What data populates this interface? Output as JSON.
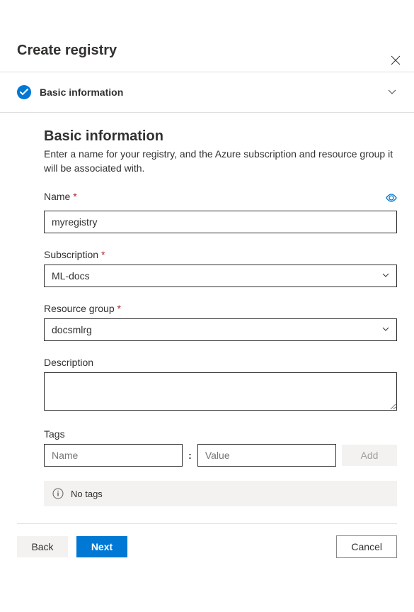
{
  "header": {
    "title": "Create registry"
  },
  "step": {
    "title": "Basic information"
  },
  "section": {
    "title": "Basic information",
    "description": "Enter a name for your registry, and the Azure subscription and resource group it will be associated with."
  },
  "fields": {
    "name": {
      "label": "Name",
      "value": "myregistry"
    },
    "subscription": {
      "label": "Subscription",
      "value": "ML-docs"
    },
    "resource_group": {
      "label": "Resource group",
      "value": "docsmlrg"
    },
    "description": {
      "label": "Description",
      "value": ""
    },
    "tags": {
      "label": "Tags",
      "name_placeholder": "Name",
      "value_placeholder": "Value",
      "add_label": "Add",
      "empty_text": "No tags"
    }
  },
  "footer": {
    "back": "Back",
    "next": "Next",
    "cancel": "Cancel"
  }
}
